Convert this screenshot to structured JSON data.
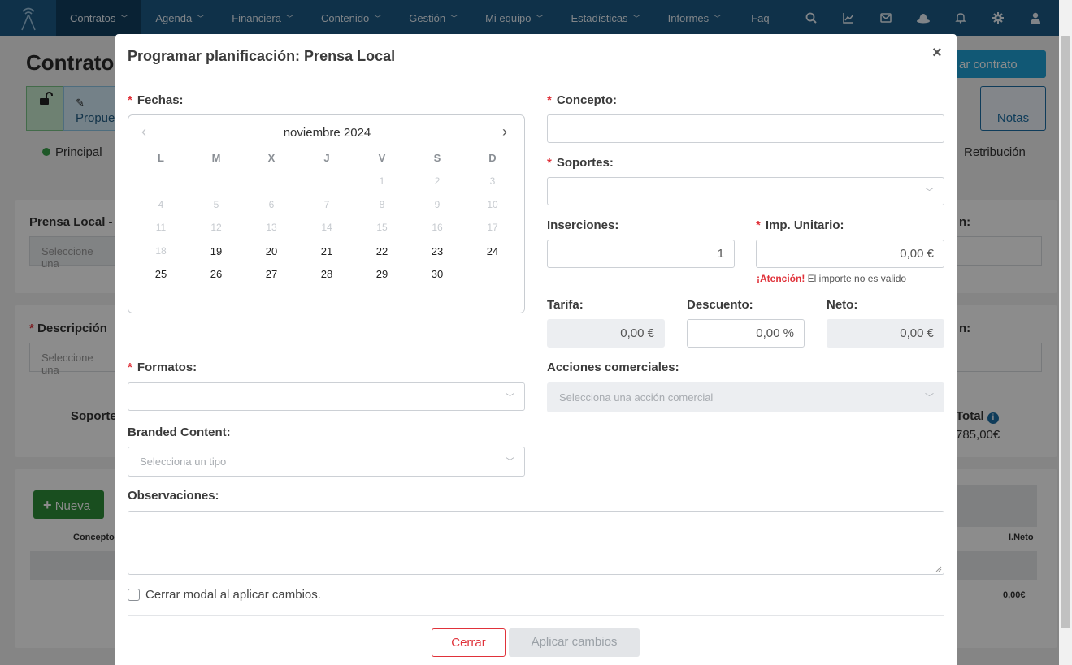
{
  "nav": {
    "items": [
      {
        "label": "Contratos",
        "active": true
      },
      {
        "label": "Agenda"
      },
      {
        "label": "Financiera"
      },
      {
        "label": "Contenido"
      },
      {
        "label": "Gestión"
      },
      {
        "label": "Mi equipo"
      },
      {
        "label": "Estadísticas"
      },
      {
        "label": "Informes"
      }
    ],
    "faq": "Faq",
    "icons": [
      "search-icon",
      "chart-icon",
      "mail-icon",
      "hat-icon",
      "bell-icon",
      "gear-icon",
      "user-icon"
    ]
  },
  "background": {
    "title": "Contrato",
    "new_contract_button": "ar contrato",
    "proposal_button": "Propue",
    "notes_button": "Notas",
    "tab_principal": "Principal",
    "tab_retribucion": "Retribución",
    "card1_label": "Prensa Local -",
    "card1_select": "Seleccione una",
    "card1_right_label": "n:",
    "card2_label": "Descripción",
    "card2_select": "Seleccione una",
    "card2_right_label": "n:",
    "soporte_label": "Soporte",
    "total_label": "Total",
    "total_value": "785,00€",
    "nueva_button": "Nueva",
    "col_concepto": "Concepto",
    "col_ineto": "I.Neto",
    "row_total": "0,00€"
  },
  "modal": {
    "title": "Programar planificación: Prensa Local",
    "close_glyph": "×",
    "fechas_label": "Fechas:",
    "calendar": {
      "month": "noviembre 2024",
      "weekdays": [
        "L",
        "M",
        "X",
        "J",
        "V",
        "S",
        "D"
      ],
      "weeks": [
        [
          null,
          null,
          null,
          null,
          "1",
          "2",
          "3"
        ],
        [
          "4",
          "5",
          "6",
          "7",
          "8",
          "9",
          "10"
        ],
        [
          "11",
          "12",
          "13",
          "14",
          "15",
          "16",
          "17"
        ],
        [
          "18",
          "19",
          "20",
          "21",
          "22",
          "23",
          "24"
        ],
        [
          "25",
          "26",
          "27",
          "28",
          "29",
          "30",
          null
        ]
      ],
      "first_enabled_day": 19
    },
    "concepto_label": "Concepto:",
    "concepto_value": "",
    "soportes_label": "Soportes:",
    "inserciones_label": "Inserciones:",
    "inserciones_value": "1",
    "imp_unitario_label": "Imp. Unitario:",
    "imp_unitario_value": "0,00 €",
    "warning_strong": "¡Atención!",
    "warning_text": "El importe no es valido",
    "tarifa_label": "Tarifa:",
    "tarifa_value": "0,00 €",
    "descuento_label": "Descuento:",
    "descuento_value": "0,00 %",
    "neto_label": "Neto:",
    "neto_value": "0,00 €",
    "formatos_label": "Formatos:",
    "acciones_label": "Acciones comerciales:",
    "acciones_placeholder": "Selecciona una acción comercial",
    "branded_label": "Branded Content:",
    "branded_placeholder": "Selecciona un tipo",
    "observaciones_label": "Observaciones:",
    "checkbox_label": "Cerrar modal al aplicar cambios.",
    "cerrar_button": "Cerrar",
    "aplicar_button": "Aplicar cambios"
  },
  "colors": {
    "nav_bg": "#1c5a86",
    "required": "#e0323a",
    "primary_green": "#2f8f3a"
  }
}
